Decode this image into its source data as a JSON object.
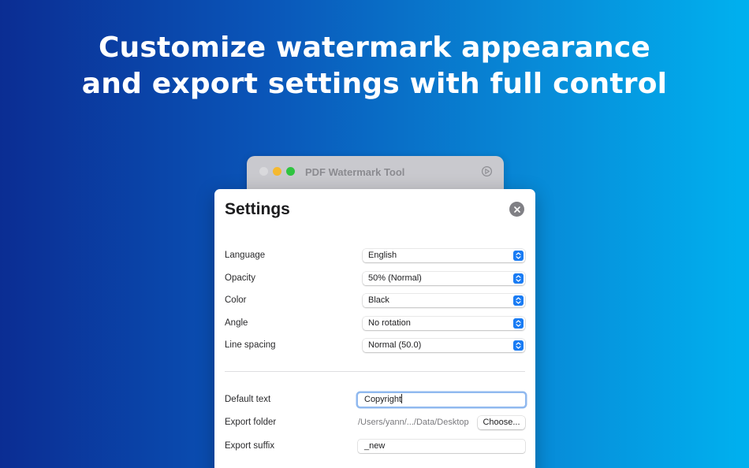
{
  "headline": {
    "line1": "Customize watermark appearance",
    "line2": "and export settings with full control"
  },
  "app_window": {
    "title": "PDF Watermark Tool"
  },
  "settings": {
    "title": "Settings",
    "selects": [
      {
        "label": "Language",
        "value": "English"
      },
      {
        "label": "Opacity",
        "value": "50% (Normal)"
      },
      {
        "label": "Color",
        "value": "Black"
      },
      {
        "label": "Angle",
        "value": "No rotation"
      },
      {
        "label": "Line spacing",
        "value": "Normal (50.0)"
      }
    ],
    "default_text": {
      "label": "Default text",
      "value": "Copyright"
    },
    "export_folder": {
      "label": "Export folder",
      "path": "/Users/yann/.../Data/Desktop",
      "button": "Choose..."
    },
    "export_suffix": {
      "label": "Export suffix",
      "value": "_new"
    }
  },
  "colors": {
    "accent": "#1a7cf4",
    "focus_ring": "#90b9ef",
    "traffic_min": "#f5b930",
    "traffic_max": "#2fc440"
  }
}
